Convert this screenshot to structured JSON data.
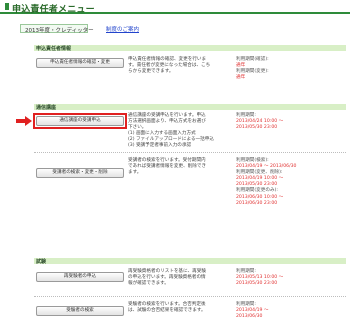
{
  "header": {
    "title": "申込責任者メニュー"
  },
  "year_bar": {
    "label": "2013年度・クレディッター",
    "link": "制度のご案内"
  },
  "sections": {
    "manager_info": {
      "title": "申込責任者情報"
    },
    "correspondence": {
      "title": "通信講座"
    },
    "exam": {
      "title": "試験"
    }
  },
  "items": {
    "manager_edit": {
      "button": "申込責任者情報の確認・変更",
      "desc": [
        "申込責任者情報の確認、変更を行いま",
        "す。責任者が変更になった場合は、こち",
        "らから変更できます。"
      ],
      "period_label": "利用期間(確認):",
      "period_status": "通年",
      "period_label2": "利用期間(変更):",
      "period_status2": "通年"
    },
    "course_apply": {
      "button": "通信講座の受講申込",
      "desc": [
        "通信講座の受講申込を行います。申込",
        "方法選択画面より、申込方式をお選び",
        "下さい。",
        "(1) 画面に入力する画面入力方式",
        "(2) ファイルアップロードによる一括申込",
        "(3) 受講予定者事前入力の承認"
      ],
      "period_label": "利用期間:",
      "period": [
        "2013/04/24 10:00 ～",
        "2013/05/30 23:00"
      ]
    },
    "learner_search": {
      "button": "受講者の検索・変更・削除",
      "desc": [
        "受講者の検索を行います。受付期間内",
        "であれば受講者情報を変更、削除でき",
        "ます。"
      ],
      "period_label": "利用期間(検索):",
      "period_search": "2013/04/19 ～ 2013/06/30",
      "period_label2": "利用期間(変更、削除):",
      "period_change": [
        "2013/04/19 10:00 ～",
        "2013/05/30 23:00"
      ],
      "period_label3": "利用期間(変更のみ):",
      "period_only": [
        "2013/06/30 10:00 ～",
        "2013/06/30 23:00"
      ]
    },
    "exam_apply": {
      "button": "再受験者の申込",
      "desc": [
        "再受験資格者のリストを基に、再受験",
        "の申込を行います。再受験資格者の情",
        "報が確認できます。"
      ],
      "period_label": "利用期間:",
      "period": [
        "2013/05/13 10:00 ～",
        "2013/05/30 23:00"
      ]
    },
    "examinee_search": {
      "button": "受験者の検索",
      "desc": [
        "受験者の検索を行います。合否判定後",
        "は、試験の合否結果を確認できます。"
      ],
      "period_label": "利用期間:",
      "period": [
        "2013/04/19 ～",
        "2013/06/30"
      ]
    }
  },
  "colors": {
    "accent": "#2e8b3a",
    "section_bg": "#d8efc6",
    "highlight": "#e02020",
    "link": "#2244cc"
  }
}
